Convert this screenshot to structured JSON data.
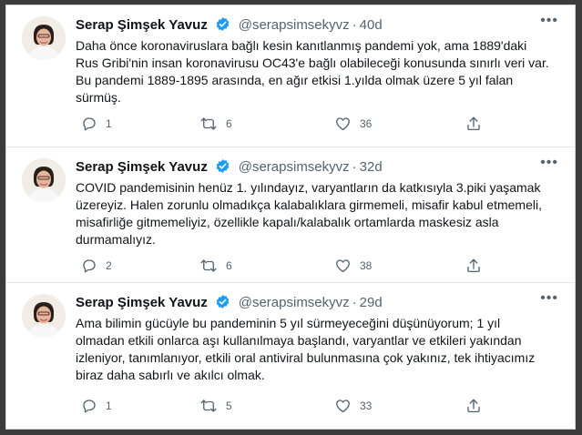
{
  "colors": {
    "verified": "#1d9bf0",
    "text": "#0f1419",
    "muted": "#536471",
    "divider": "#e1e8ed"
  },
  "tweets": [
    {
      "author": "Serap Şimşek Yavuz",
      "handle": "@serapsimsekyvz",
      "separator": "·",
      "time": "40d",
      "text": "Daha önce koronaviruslara bağlı kesin kanıtlanmış pandemi yok, ama 1889'daki Rus Gribi'nin  insan koronavirusu OC43'e bağlı olabileceği konusunda sınırlı veri var. Bu pandemi 1889-1895 arasında, en ağır etkisi 1.yılda olmak üzere 5 yıl falan sürmüş.",
      "replies": "1",
      "retweets": "6",
      "likes": "36"
    },
    {
      "author": "Serap Şimşek Yavuz",
      "handle": "@serapsimsekyvz",
      "separator": "·",
      "time": "32d",
      "text": "COVID pandemisinin henüz 1. yılındayız, varyantların da katkısıyla 3.piki yaşamak üzereyiz. Halen zorunlu olmadıkça kalabalıklara girmemeli, misafir kabul etmemeli, misafirliğe gitmemeliyiz, özellikle kapalı/kalabalık ortamlarda maskesiz asla durmamalıyız.",
      "replies": "2",
      "retweets": "6",
      "likes": "38"
    },
    {
      "author": "Serap Şimşek Yavuz",
      "handle": "@serapsimsekyvz",
      "separator": "·",
      "time": "29d",
      "text": "Ama bilimin gücüyle bu pandeminin 5 yıl sürmeyeceğini düşünüyorum;  1 yıl olmadan etkili onlarca aşı kullanılmaya başlandı, varyantlar ve etkileri yakından izleniyor, tanımlanıyor, etkili oral antiviral bulunmasına çok yakınız, tek ihtiyacımız biraz daha sabırlı ve akılcı olmak.",
      "replies": "1",
      "retweets": "5",
      "likes": "33"
    }
  ],
  "icons": {
    "more": "more-icon",
    "reply": "reply-icon",
    "retweet": "retweet-icon",
    "like": "heart-icon",
    "share": "share-icon",
    "verified": "verified-badge-icon"
  }
}
